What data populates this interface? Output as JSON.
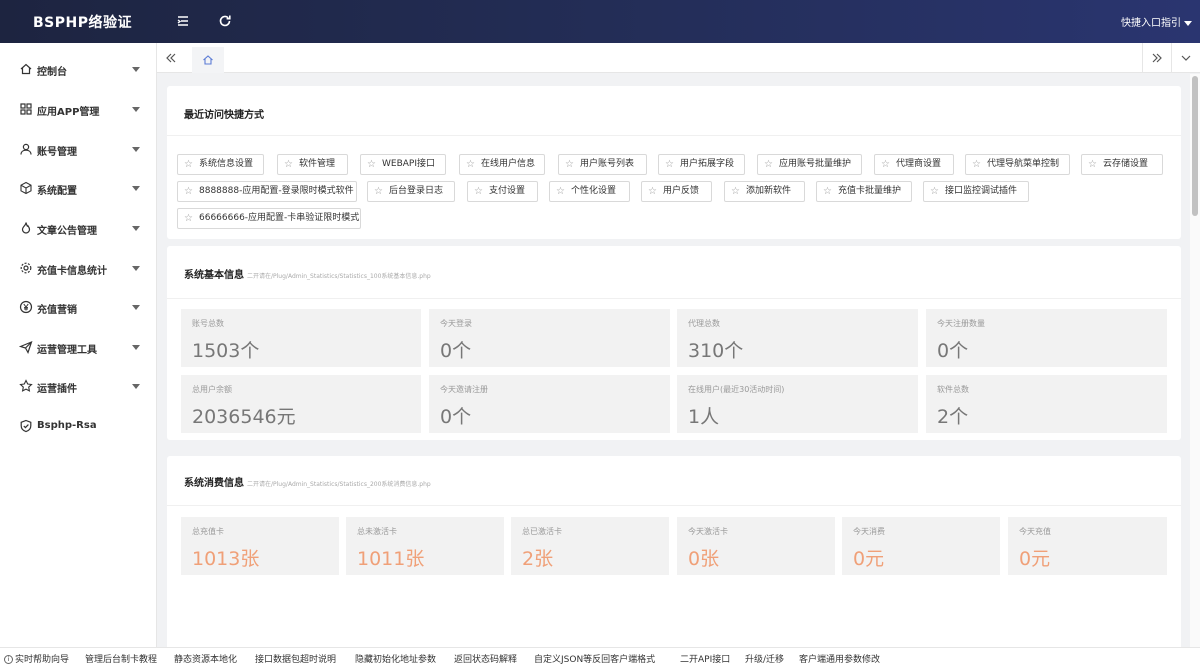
{
  "brand": "BSPHP络验证",
  "topbar": {
    "menu_icon": "menu-fold-icon",
    "refresh_icon": "refresh-icon",
    "quick_label": "快捷入口指引"
  },
  "sidebar": {
    "items": [
      {
        "label": "控制台",
        "icon": "home-icon"
      },
      {
        "label": "应用APP管理",
        "icon": "apps-icon"
      },
      {
        "label": "账号管理",
        "icon": "user-icon"
      },
      {
        "label": "系统配置",
        "icon": "cube-icon"
      },
      {
        "label": "文章公告管理",
        "icon": "fire-icon"
      },
      {
        "label": "充值卡信息统计",
        "icon": "gear-icon"
      },
      {
        "label": "充值营销",
        "icon": "yen-icon"
      },
      {
        "label": "运营管理工具",
        "icon": "send-icon"
      },
      {
        "label": "运营插件",
        "icon": "star-icon"
      },
      {
        "label": "Bsphp-Rsa",
        "icon": "shield-icon"
      }
    ]
  },
  "quick": {
    "title": "最近访问快捷方式",
    "items": [
      "系统信息设置",
      "软件管理",
      "WEBAPI接口",
      "在线用户信息",
      "用户账号列表",
      "用户拓展字段",
      "应用账号批量维护",
      "代理商设置",
      "代理导航菜单控制",
      "云存储设置",
      "8888888-应用配置-登录限时模式软件",
      "后台登录日志",
      "支付设置",
      "个性化设置",
      "用户反馈",
      "添加新软件",
      "充值卡批量维护",
      "接口监控调试插件",
      "66666666-应用配置-卡串验证限时模式"
    ]
  },
  "basic": {
    "title": "系统基本信息",
    "subtitle": "二开请在/Plug/Admin_Statistics/Statistics_100系统基本信息.php",
    "stats": [
      {
        "label": "账号总数",
        "value": "1503个"
      },
      {
        "label": "今天登录",
        "value": "0个"
      },
      {
        "label": "代理总数",
        "value": "310个"
      },
      {
        "label": "今天注册数量",
        "value": "0个"
      },
      {
        "label": "总用户余额",
        "value": "2036546元"
      },
      {
        "label": "今天邀请注册",
        "value": "0个"
      },
      {
        "label": "在线用户(最近30活动时间)",
        "value": "1人"
      },
      {
        "label": "软件总数",
        "value": "2个"
      }
    ]
  },
  "consume": {
    "title": "系统消费信息",
    "subtitle": "二开请在/Plug/Admin_Statistics/Statistics_200系统消费信息.php",
    "stats": [
      {
        "label": "总充值卡",
        "value": "1013张"
      },
      {
        "label": "总未激活卡",
        "value": "1011张"
      },
      {
        "label": "总已激活卡",
        "value": "2张"
      },
      {
        "label": "今天激活卡",
        "value": "0张"
      },
      {
        "label": "今天消费",
        "value": "0元"
      },
      {
        "label": "今天充值",
        "value": "0元"
      }
    ]
  },
  "footer": {
    "items": [
      "实时帮助向导",
      "管理后台制卡教程",
      "静态资源本地化",
      "接口数据包超时说明",
      "隐藏初始化地址参数",
      "返回状态码解释",
      "自定义JSON等反回客户端格式",
      "二开API接口",
      "升级/迁移",
      "客户端通用参数修改"
    ]
  },
  "colors": {
    "topbar": "#1d2440",
    "accent_orange": "#f0a078",
    "home_tab": "#5b7bd5"
  }
}
